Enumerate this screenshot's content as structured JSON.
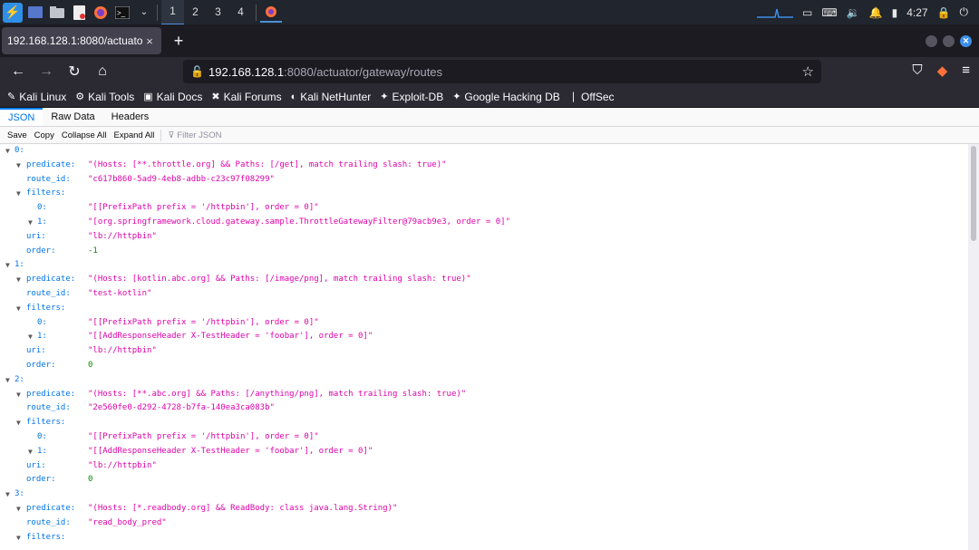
{
  "panel": {
    "workspaces": [
      "1",
      "2",
      "3",
      "4"
    ],
    "clock": "4:27"
  },
  "tab": {
    "title": "192.168.128.1:8080/actuator/",
    "close": "×",
    "new": "+"
  },
  "nav": {
    "url_host": "192.168.128.1",
    "url_path": ":8080/actuator/gateway/routes"
  },
  "bookmarks": [
    {
      "label": "Kali Linux",
      "icon": "✎"
    },
    {
      "label": "Kali Tools",
      "icon": "⚙"
    },
    {
      "label": "Kali Docs",
      "icon": "▣"
    },
    {
      "label": "Kali Forums",
      "icon": "✖"
    },
    {
      "label": "Kali NetHunter",
      "icon": "◐"
    },
    {
      "label": "Exploit-DB",
      "icon": "✦"
    },
    {
      "label": "Google Hacking DB",
      "icon": "✦"
    },
    {
      "label": "OffSec",
      "icon": "❘"
    }
  ],
  "viewer": {
    "tabs": [
      "JSON",
      "Raw Data",
      "Headers"
    ],
    "tools": [
      "Save",
      "Copy",
      "Collapse All",
      "Expand All"
    ],
    "filter_placeholder": "Filter JSON"
  },
  "tree": [
    {
      "i": 0,
      "tw": true,
      "key": "0:",
      "val": "",
      "t": ""
    },
    {
      "i": 1,
      "tw": true,
      "key": "predicate:",
      "val": "\"(Hosts: [**.throttle.org] && Paths: [/get], match trailing slash: true)\"",
      "t": "str"
    },
    {
      "i": 1,
      "tw": false,
      "key": "route_id:",
      "val": "\"c617b860-5ad9-4eb8-adbb-c23c97f08299\"",
      "t": "str"
    },
    {
      "i": 1,
      "tw": true,
      "key": "filters:",
      "val": "",
      "t": ""
    },
    {
      "i": 2,
      "tw": false,
      "key": "0:",
      "val": "\"[[PrefixPath prefix = '/httpbin'], order = 0]\"",
      "t": "str"
    },
    {
      "i": 2,
      "tw": true,
      "key": "1:",
      "val": "\"[org.springframework.cloud.gateway.sample.ThrottleGatewayFilter@79acb9e3, order = 0]\"",
      "t": "str"
    },
    {
      "i": 1,
      "tw": false,
      "key": "uri:",
      "val": "\"lb://httpbin\"",
      "t": "str"
    },
    {
      "i": 1,
      "tw": false,
      "key": "order:",
      "val": "-1",
      "t": "num"
    },
    {
      "i": 0,
      "tw": true,
      "key": "1:",
      "val": "",
      "t": ""
    },
    {
      "i": 1,
      "tw": true,
      "key": "predicate:",
      "val": "\"(Hosts: [kotlin.abc.org] && Paths: [/image/png], match trailing slash: true)\"",
      "t": "str"
    },
    {
      "i": 1,
      "tw": false,
      "key": "route_id:",
      "val": "\"test-kotlin\"",
      "t": "str"
    },
    {
      "i": 1,
      "tw": true,
      "key": "filters:",
      "val": "",
      "t": ""
    },
    {
      "i": 2,
      "tw": false,
      "key": "0:",
      "val": "\"[[PrefixPath prefix = '/httpbin'], order = 0]\"",
      "t": "str"
    },
    {
      "i": 2,
      "tw": true,
      "key": "1:",
      "val": "\"[[AddResponseHeader X-TestHeader = 'foobar'], order = 0]\"",
      "t": "str"
    },
    {
      "i": 1,
      "tw": false,
      "key": "uri:",
      "val": "\"lb://httpbin\"",
      "t": "str"
    },
    {
      "i": 1,
      "tw": false,
      "key": "order:",
      "val": "0",
      "t": "num"
    },
    {
      "i": 0,
      "tw": true,
      "key": "2:",
      "val": "",
      "t": ""
    },
    {
      "i": 1,
      "tw": true,
      "key": "predicate:",
      "val": "\"(Hosts: [**.abc.org] && Paths: [/anything/png], match trailing slash: true)\"",
      "t": "str"
    },
    {
      "i": 1,
      "tw": false,
      "key": "route_id:",
      "val": "\"2e560fe0-d292-4728-b7fa-140ea3ca083b\"",
      "t": "str"
    },
    {
      "i": 1,
      "tw": true,
      "key": "filters:",
      "val": "",
      "t": ""
    },
    {
      "i": 2,
      "tw": false,
      "key": "0:",
      "val": "\"[[PrefixPath prefix = '/httpbin'], order = 0]\"",
      "t": "str"
    },
    {
      "i": 2,
      "tw": true,
      "key": "1:",
      "val": "\"[[AddResponseHeader X-TestHeader = 'foobar'], order = 0]\"",
      "t": "str"
    },
    {
      "i": 1,
      "tw": false,
      "key": "uri:",
      "val": "\"lb://httpbin\"",
      "t": "str"
    },
    {
      "i": 1,
      "tw": false,
      "key": "order:",
      "val": "0",
      "t": "num"
    },
    {
      "i": 0,
      "tw": true,
      "key": "3:",
      "val": "",
      "t": ""
    },
    {
      "i": 1,
      "tw": true,
      "key": "predicate:",
      "val": "\"(Hosts: [*.readbody.org] && ReadBody: class java.lang.String)\"",
      "t": "str"
    },
    {
      "i": 1,
      "tw": false,
      "key": "route_id:",
      "val": "\"read_body_pred\"",
      "t": "str"
    },
    {
      "i": 1,
      "tw": true,
      "key": "filters:",
      "val": "",
      "t": ""
    }
  ]
}
